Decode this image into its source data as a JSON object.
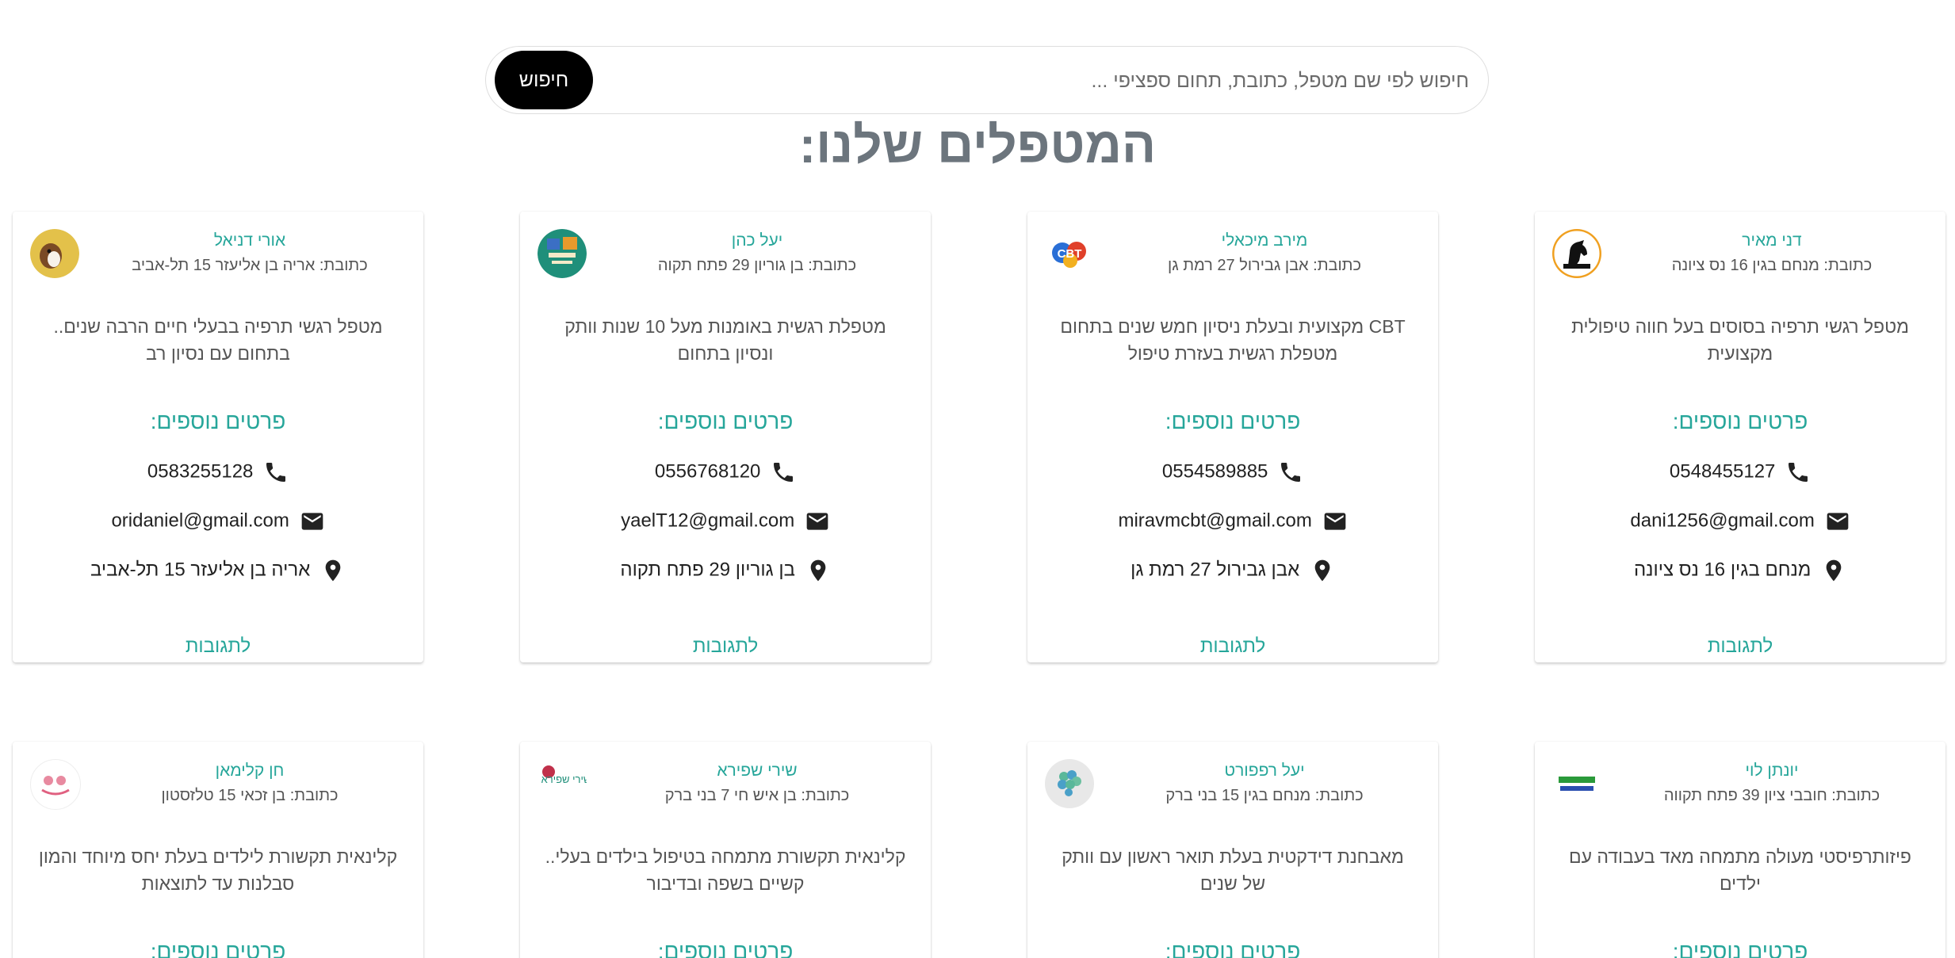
{
  "search": {
    "placeholder": "חיפוש לפי שם מטפל, כתובת, תחום ספציפי ...",
    "button_label": "חיפוש"
  },
  "page_title": "המטפלים שלנו:",
  "labels": {
    "more_details": "פרטים נוספים:",
    "reactions": "לתגובות"
  },
  "colors": {
    "accent": "#26a69a",
    "title_gray": "#6c757d",
    "search_button": "#000000"
  },
  "cards": [
    {
      "name": "דני מאיר",
      "address": "כתובת: מנחם בגין 16 נס ציונה",
      "description": "מטפל רגשי תרפיה בסוסים בעל חווה טיפולית מקצועית",
      "phone": "0548455127",
      "email": "dani1256@gmail.com",
      "location": "מנחם בגין 16 נס ציונה",
      "avatar_icon": "horse-logo-icon"
    },
    {
      "name": "מירב מיכאלי",
      "address": "כתובת: אבן גבירול 27 רמת גן",
      "description": "CBT מקצועית ובעלת ניסיון חמש שנים בתחום מטפלת רגשית בעזרת טיפול",
      "phone": "0554589885",
      "email": "miravmcbt@gmail.com",
      "location": "אבן גבירול 27 רמת גן",
      "avatar_icon": "cbt-logo-icon",
      "avatar_text": "CBT"
    },
    {
      "name": "יעל כהן",
      "address": "כתובת: בן גוריון 29 פתח תקוה",
      "description": "מטפלת רגשית באומנות מעל 10 שנות וותק ונסיון בתחום",
      "phone": "0556768120",
      "email": "yaelT12@gmail.com",
      "location": "בן גוריון 29 פתח תקוה",
      "avatar_icon": "art-therapy-logo-icon"
    },
    {
      "name": "אורי דניאל",
      "address": "כתובת: אריה בן אליעזר 15 תל-אביב",
      "description": "מטפל רגשי תרפיה בבעלי חיים הרבה שנים.. בתחום עם נסיון רב",
      "phone": "0583255128",
      "email": "oridaniel@gmail.com",
      "location": "אריה בן אליעזר 15 תל-אביב",
      "avatar_icon": "dog-photo-icon"
    },
    {
      "name": "יונתן לוי",
      "address": "כתובת: חובבי ציון 39 פתח תקווה",
      "description": "פיזותרפיסטי מעולה מתמחה מאד בעבודה עם ילדים",
      "avatar_icon": "physio-logo-icon"
    },
    {
      "name": "יעל רפפורט",
      "address": "כתובת: מנחם בגין 15 בני ברק",
      "description": "מאבחנת דידקטית בעלת תואר ראשון עם וותק של שנים",
      "avatar_icon": "brain-logo-icon"
    },
    {
      "name": "שירי שפירא",
      "address": "כתובת: בן איש חי 7 בני ברק",
      "description": "קלינאית תקשורת מתמחה בטיפול בילדים בעלי.. קשיים בשפה ובדיבור",
      "avatar_icon": "speech-therapy-logo-icon",
      "avatar_text": "שירי שפירא"
    },
    {
      "name": "חן קלימאן",
      "address": "כתובת: בן זכאי 15 טלזסטון",
      "description": "קלינאית תקשורת לילדים בעלת יחס מיוחד והמון סבלנות עד לתוצאות",
      "avatar_icon": "kids-logo-icon"
    }
  ]
}
